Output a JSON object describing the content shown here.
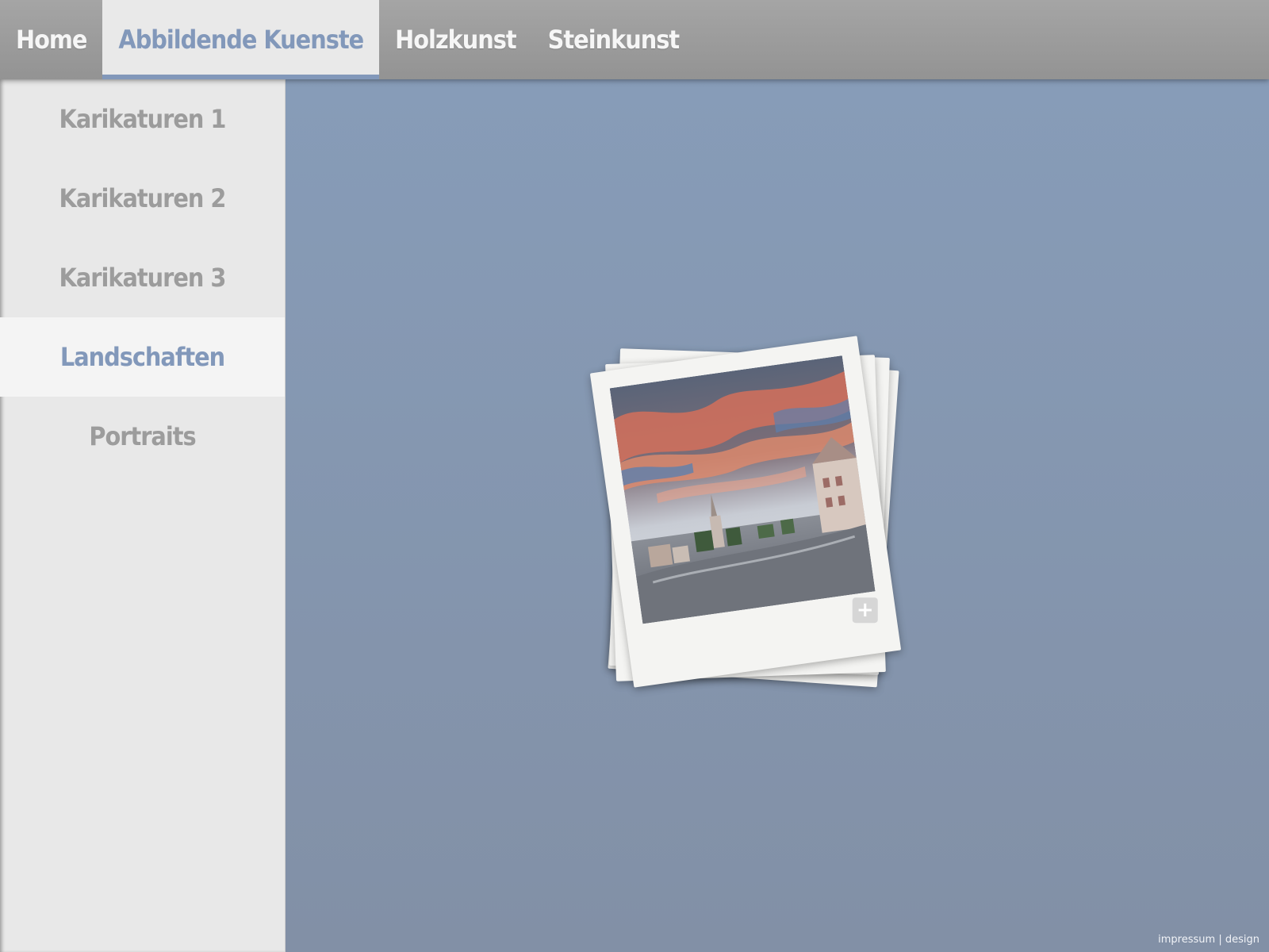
{
  "topnav": {
    "items": [
      {
        "label": "Home"
      },
      {
        "label": "Abbildende Kuenste",
        "active": true
      },
      {
        "label": "Holzkunst"
      },
      {
        "label": "Steinkunst"
      }
    ]
  },
  "sidebar": {
    "items": [
      {
        "label": "Karikaturen 1"
      },
      {
        "label": "Karikaturen 2"
      },
      {
        "label": "Karikaturen 3"
      },
      {
        "label": "Landschaften",
        "active": true
      },
      {
        "label": "Portraits"
      }
    ]
  },
  "gallery": {
    "expand_icon": "plus-icon",
    "expand_symbol": "+"
  },
  "footer": {
    "impressum": "impressum",
    "separator": "|",
    "design": "design"
  },
  "colors": {
    "accent": "#8298ba",
    "topbar": "#9c9c9c",
    "sidebar": "#e8e8e8",
    "background": "#8496b0"
  }
}
